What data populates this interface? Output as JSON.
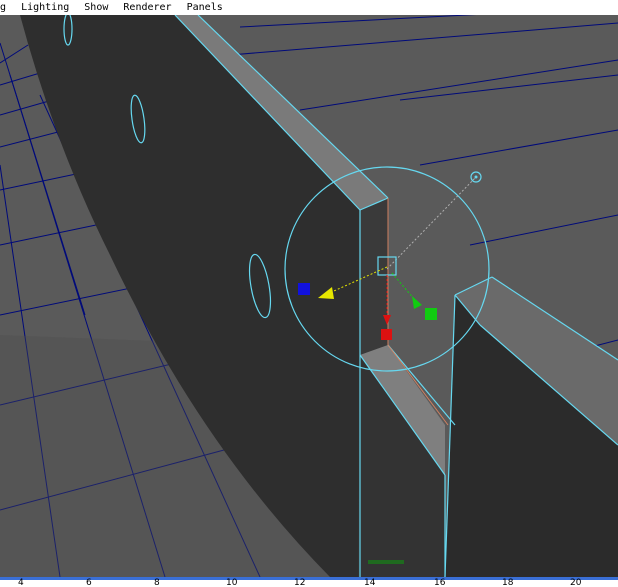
{
  "menu": {
    "items": [
      {
        "id": "shading",
        "label": "ng"
      },
      {
        "id": "lighting",
        "label": "Lighting"
      },
      {
        "id": "show",
        "label": "Show"
      },
      {
        "id": "renderer",
        "label": "Renderer"
      },
      {
        "id": "panels",
        "label": "Panels"
      }
    ]
  },
  "timeline": {
    "ticks": [
      "4",
      "6",
      "8",
      "10",
      "12",
      "14",
      "16",
      "18",
      "20"
    ]
  },
  "colors": {
    "viewport_bg": "#5c5c5c",
    "grid_line": "#000a7a",
    "selection_wire": "#66d8f0",
    "pivot_x": "#dd1111",
    "pivot_y": "#11cc11",
    "pivot_z": "#1111dd",
    "light_direction": "#e6e600",
    "timeline_accent": "#3a6fd6"
  }
}
